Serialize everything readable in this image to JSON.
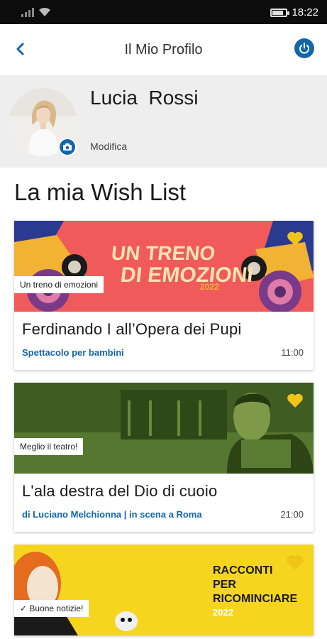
{
  "status_bar": {
    "time": "18:22",
    "battery_level": 0.8
  },
  "header": {
    "title": "Il Mio Profilo"
  },
  "profile": {
    "name": "Lucia  Rossi",
    "edit_label": "Modifica"
  },
  "wishlist": {
    "title": "La mia Wish List",
    "items": [
      {
        "banner_text_1": "UN TRENO",
        "banner_text_2": "DI EMOZIONI",
        "banner_year": "2022",
        "tag": "Un treno di emozioni",
        "title": "Ferdinando I all’Opera dei Pupi",
        "subtitle": "Spettacolo per bambini",
        "time": "11:00",
        "heart_color": "#f0c419"
      },
      {
        "tag": "Meglio il teatro!",
        "title": "L'ala destra del Dio di cuoio",
        "subtitle": "di Luciano Melchionna | in scena a Roma",
        "time": "21:00",
        "heart_color": "#f0c419"
      },
      {
        "banner_lines": [
          "RACCONTI",
          "PER",
          "RICOMINCIARE"
        ],
        "banner_year": "2022",
        "tag": "✓ Buone notizie!",
        "heart_color": "#f0c419"
      }
    ]
  },
  "colors": {
    "accent": "#1366a8",
    "banner1": "#f05a5b",
    "banner2": "#4b6b2a",
    "banner3": "#f6d51e"
  }
}
